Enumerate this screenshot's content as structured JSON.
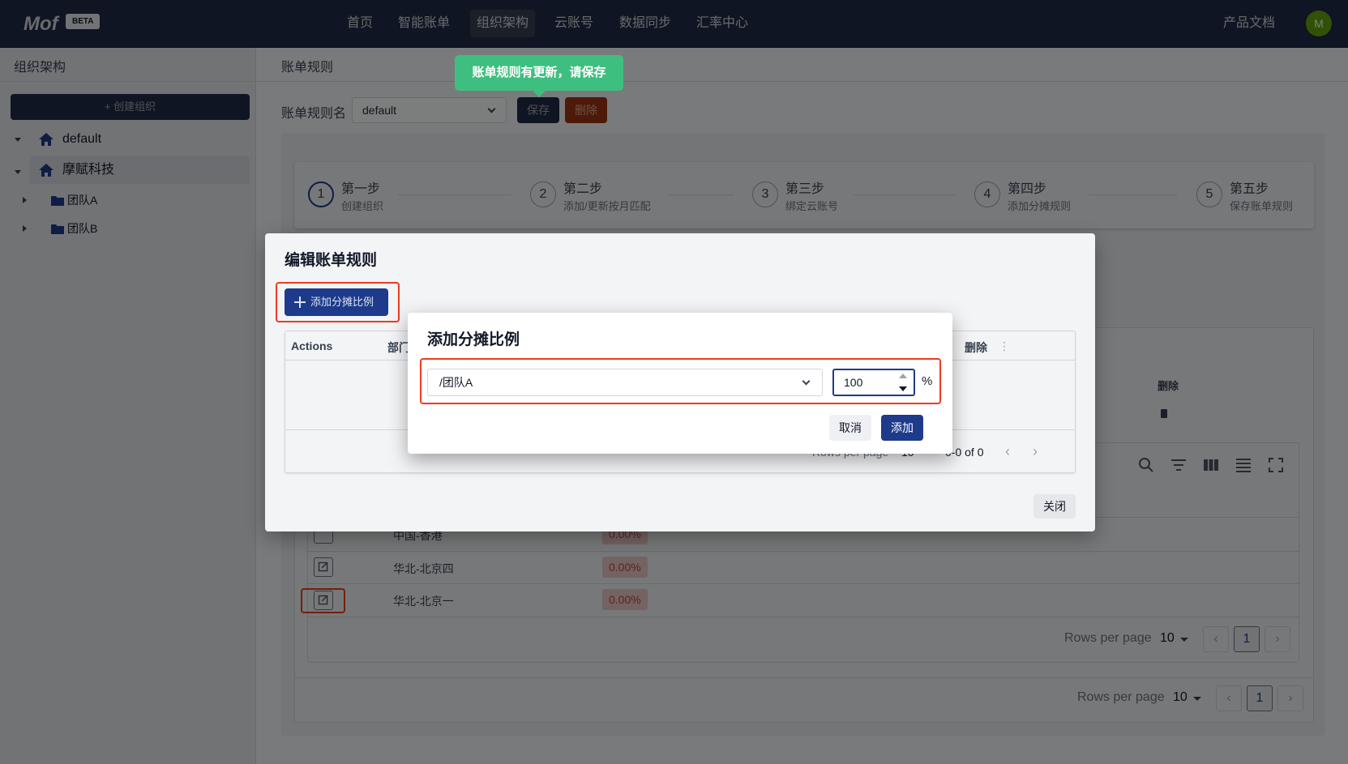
{
  "app": {
    "logo": "Mof",
    "badge": "BETA"
  },
  "nav": {
    "items": [
      "首页",
      "智能账单",
      "组织架构",
      "云账号",
      "数据同步",
      "汇率中心"
    ],
    "active": "组织架构",
    "docs": "产品文档",
    "avatar": "M"
  },
  "sidebar": {
    "title": "组织架构",
    "create_label": "+ 创建组织",
    "tree": [
      {
        "label": "default",
        "icon": "home-icon",
        "level": 0,
        "expanded": true
      },
      {
        "label": "摩赋科技",
        "icon": "home-icon",
        "level": 0,
        "expanded": true,
        "selected": true
      },
      {
        "label": "团队A",
        "icon": "folder-icon",
        "level": 1,
        "expanded": false
      },
      {
        "label": "团队B",
        "icon": "folder-icon",
        "level": 1,
        "expanded": false
      }
    ]
  },
  "main": {
    "title": "账单规则",
    "rule_name_label": "账单规则名",
    "rule_name_value": "default",
    "save_label": "保存",
    "delete_label": "删除",
    "tooltip": "账单规则有更新，请保存",
    "steps": [
      {
        "num": "1",
        "title": "第一步",
        "sub": "创建组织",
        "active": true
      },
      {
        "num": "2",
        "title": "第二步",
        "sub": "添加/更新按月匹配",
        "active": false
      },
      {
        "num": "3",
        "title": "第三步",
        "sub": "绑定云账号",
        "active": false
      },
      {
        "num": "4",
        "title": "第四步",
        "sub": "添加分摊规则",
        "active": false
      },
      {
        "num": "5",
        "title": "第五步",
        "sub": "保存账单规则",
        "active": false
      }
    ],
    "table_col_delete": "删除",
    "rows": [
      {
        "region": "中国-香港",
        "pct": "0.00%"
      },
      {
        "region": "华北-北京四",
        "pct": "0.00%"
      },
      {
        "region": "华北-北京一",
        "pct": "0.00%"
      }
    ],
    "inner_pagination": {
      "rows_per_page_label": "Rows per page",
      "rows_per_page": "10",
      "page": "1"
    },
    "outer_pagination": {
      "rows_per_page_label": "Rows per page",
      "rows_per_page": "10",
      "page": "1"
    }
  },
  "edit_dialog": {
    "title": "编辑账单规则",
    "add_ratio_label": "添加分摊比例",
    "col_actions": "Actions",
    "col_dept": "部门",
    "col_delete": "删除",
    "pagination": {
      "rows_per_page_label": "Rows per page",
      "rows_per_page": "10",
      "range": "0-0 of 0"
    },
    "close_label": "关闭"
  },
  "add_dialog": {
    "title": "添加分摊比例",
    "team_value": "/团队A",
    "ratio_value": "100",
    "unit": "%",
    "cancel_label": "取消",
    "add_label": "添加"
  }
}
